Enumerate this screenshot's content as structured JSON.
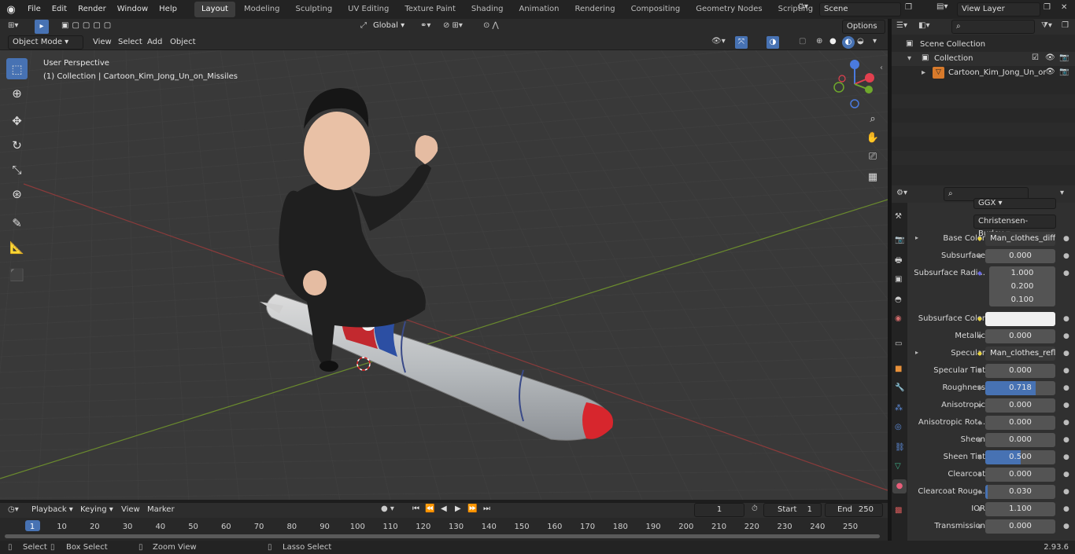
{
  "menus": [
    "File",
    "Edit",
    "Render",
    "Window",
    "Help"
  ],
  "workspaces": [
    "Layout",
    "Modeling",
    "Sculpting",
    "UV Editing",
    "Texture Paint",
    "Shading",
    "Animation",
    "Rendering",
    "Compositing",
    "Geometry Nodes",
    "Scripting"
  ],
  "scene": "Scene",
  "view_layer": "View Layer",
  "header": {
    "transform": "Global",
    "options": "Options"
  },
  "viewport_header": {
    "mode": "Object Mode",
    "items": [
      "View",
      "Select",
      "Add",
      "Object"
    ]
  },
  "overlay": {
    "perspective": "User Perspective",
    "collection": "(1) Collection | Cartoon_Kim_Jong_Un_on_Missiles"
  },
  "outliner": {
    "root": "Scene Collection",
    "collection": "Collection",
    "object": "Cartoon_Kim_Jong_Un_or"
  },
  "props": {
    "distribution": "GGX",
    "subsurface_method": "Christensen-Burley",
    "rows": [
      {
        "label": "Base Color",
        "value": "Man_clothes_diffuse...",
        "kind": "link",
        "expand": true
      },
      {
        "label": "Subsurface",
        "value": "0.000"
      },
      {
        "label": "Subsurface Radi...",
        "value": "1.000",
        "kind": "vec"
      },
      {
        "label": "",
        "value": "0.200",
        "kind": "vec"
      },
      {
        "label": "",
        "value": "0.100",
        "kind": "vec"
      },
      {
        "label": "Subsurface Color",
        "value": "",
        "kind": "color"
      },
      {
        "label": "Metallic",
        "value": "0.000"
      },
      {
        "label": "Specular",
        "value": "Man_clothes_reflecti...",
        "kind": "link",
        "expand": true
      },
      {
        "label": "Specular Tint",
        "value": "0.000"
      },
      {
        "label": "Roughness",
        "value": "0.718",
        "fill": 0.718
      },
      {
        "label": "Anisotropic",
        "value": "0.000"
      },
      {
        "label": "Anisotropic Rot...",
        "value": "0.000"
      },
      {
        "label": "Sheen",
        "value": "0.000"
      },
      {
        "label": "Sheen Tint",
        "value": "0.500",
        "fill": 0.5
      },
      {
        "label": "Clearcoat",
        "value": "0.000"
      },
      {
        "label": "Clearcoat Roug...",
        "value": "0.030",
        "fill": 0.03
      },
      {
        "label": "IOR",
        "value": "1.100"
      },
      {
        "label": "Transmission",
        "value": "0.000"
      }
    ]
  },
  "timeline": {
    "menus": [
      "Playback",
      "Keying",
      "View",
      "Marker"
    ],
    "current": "1",
    "start_label": "Start",
    "start": "1",
    "end_label": "End",
    "end": "250",
    "ticks": [
      "1",
      "10",
      "20",
      "30",
      "40",
      "50",
      "60",
      "70",
      "80",
      "90",
      "100",
      "110",
      "120",
      "130",
      "140",
      "150",
      "160",
      "170",
      "180",
      "190",
      "200",
      "210",
      "220",
      "230",
      "240",
      "250"
    ]
  },
  "status": {
    "select": "Select",
    "box": "Box Select",
    "zoom": "Zoom View",
    "lasso": "Lasso Select",
    "version": "2.93.6"
  },
  "colors": {
    "accent": "#4772b3",
    "viewport": "#393939",
    "panel": "#303030"
  }
}
